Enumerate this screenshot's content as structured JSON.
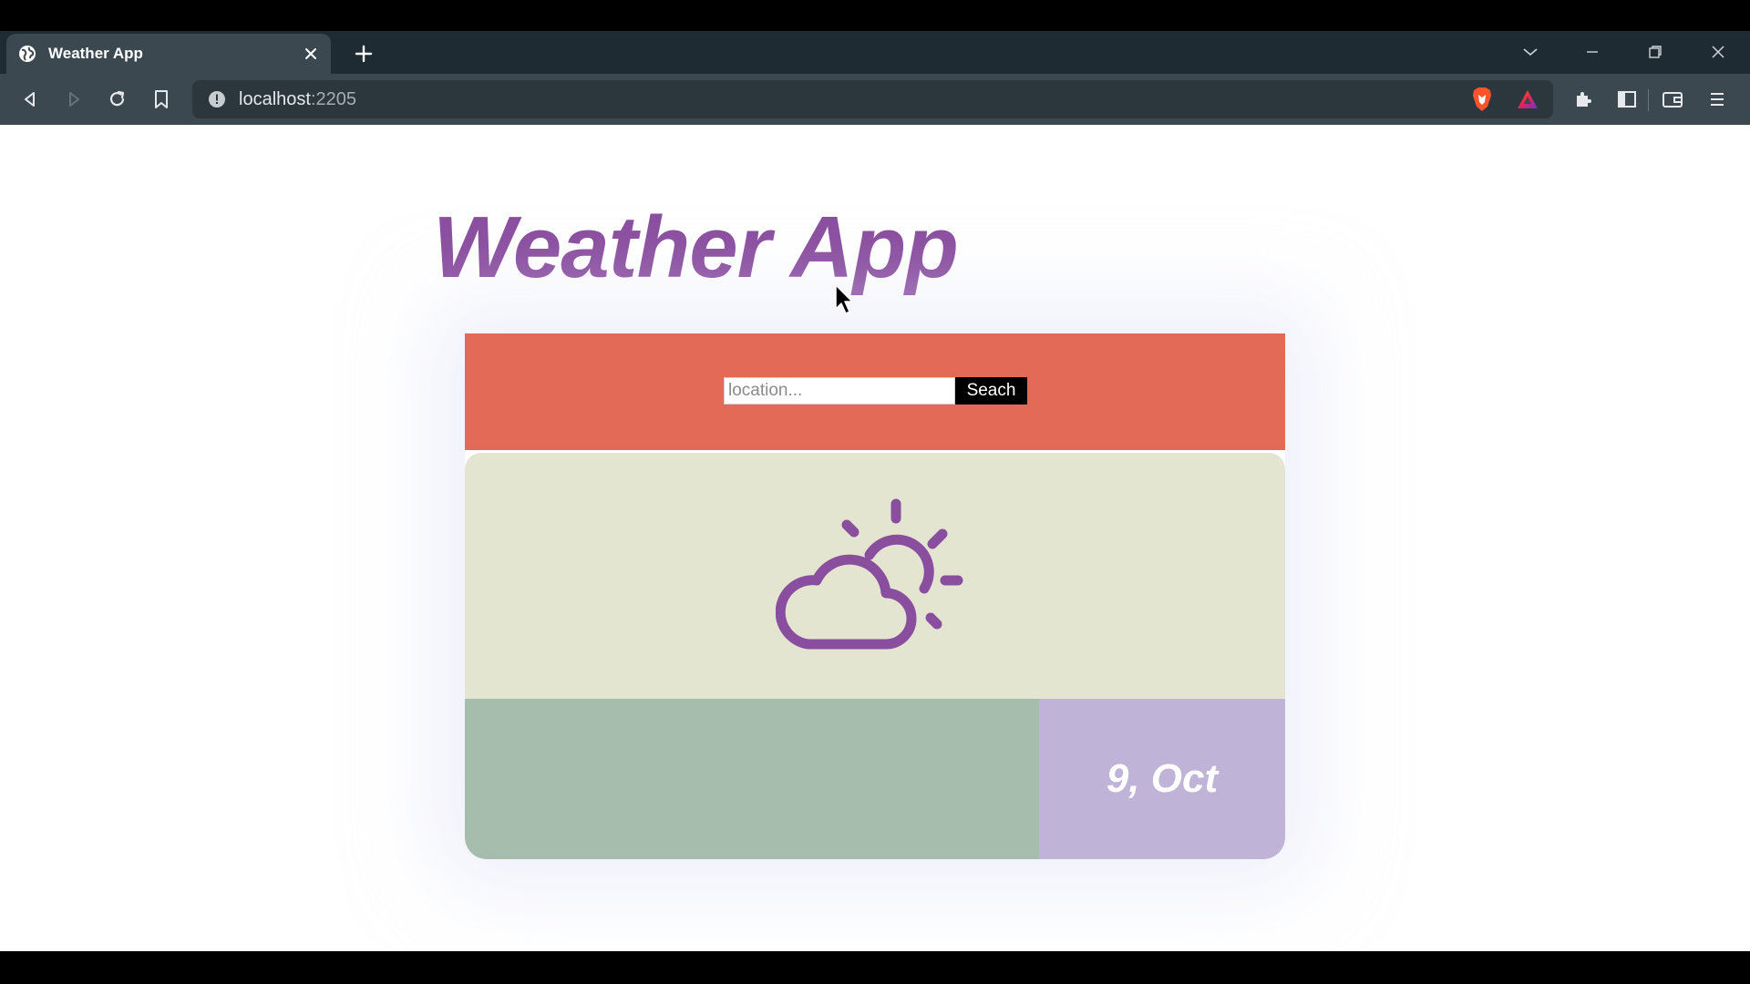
{
  "browser": {
    "tab": {
      "title": "Weather App",
      "favicon": "globe-icon"
    },
    "address_bar": {
      "host": "localhost",
      "port": ":2205"
    },
    "icons": {
      "back": "back-arrow-icon",
      "forward": "forward-arrow-icon",
      "reload": "reload-icon",
      "bookmark": "bookmark-icon",
      "site_info": "info-icon",
      "brave": "brave-shield-icon",
      "rewards": "brave-rewards-icon",
      "extensions": "puzzle-icon",
      "sidebar": "sidebar-icon",
      "wallet": "wallet-icon",
      "menu": "hamburger-menu-icon"
    }
  },
  "page": {
    "title": "Weather App",
    "search": {
      "placeholder": "location...",
      "value": "",
      "button_label": "Seach"
    },
    "weather_icon": "partly-cloudy-icon",
    "temperature": "",
    "date": "9, Oct"
  },
  "colors": {
    "title": "#8a4e9f",
    "search_panel": "#e46a58",
    "icon_panel": "#e4e5d0",
    "icon": "#8a4e9f",
    "temp_panel": "#a6bdae",
    "date_panel": "#bfb3d8"
  }
}
